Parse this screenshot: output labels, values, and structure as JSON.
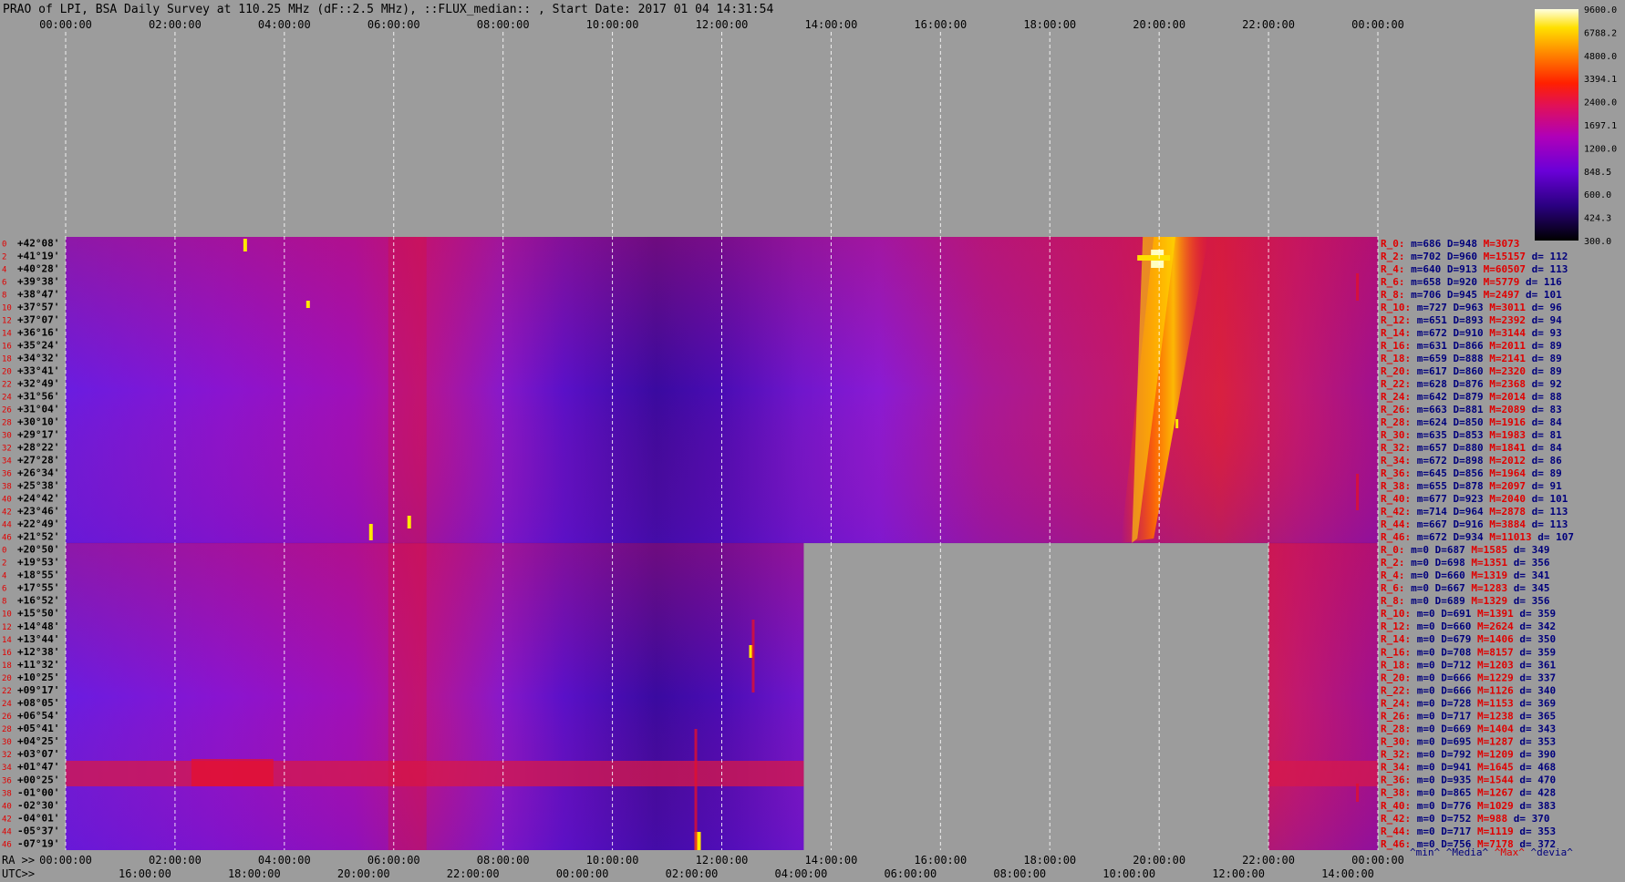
{
  "title": "PRAO of LPI, BSA Daily Survey at 110.25 MHz (dF::2.5 MHz), ::FLUX_median:: , Start Date: 2017 01 04 14:31:54",
  "colors": {
    "background": "#9c9c9c",
    "gap": "#9c9c9c",
    "axis_text": "#000000",
    "stats_label": "#e00000",
    "stats_blue": "#00007c",
    "stats_red": "#e00000",
    "grid": "#ffffff"
  },
  "chart_data": {
    "type": "heatmap",
    "title": "PRAO of LPI, BSA Daily Survey at 110.25 MHz (dF::2.5 MHz), ::FLUX_median:: , Start Date: 2017 01 04 14:31:54",
    "x_ra_ticks": [
      "00:00:00",
      "02:00:00",
      "04:00:00",
      "06:00:00",
      "08:00:00",
      "10:00:00",
      "12:00:00",
      "14:00:00",
      "16:00:00",
      "18:00:00",
      "20:00:00",
      "22:00:00",
      "00:00:00"
    ],
    "x_utc_ticks": [
      "16:00:00",
      "18:00:00",
      "20:00:00",
      "22:00:00",
      "00:00:00",
      "02:00:00",
      "04:00:00",
      "06:00:00",
      "08:00:00",
      "10:00:00",
      "12:00:00",
      "14:00:00"
    ],
    "ra_axis_label": "RA >>",
    "utc_axis_label": "UTC>>",
    "x_range_hours": [
      0,
      24
    ],
    "grid": true,
    "colorbar": {
      "ticks": [
        "9600.0",
        "6788.2",
        "4800.0",
        "3394.1",
        "2400.0",
        "1697.1",
        "1200.0",
        "848.5",
        "600.0",
        "424.3",
        "300.0"
      ],
      "range": [
        300,
        9600
      ],
      "scale": "log",
      "colormap": "gnuplot"
    },
    "block1": {
      "row_numbers": [
        "0",
        "2",
        "4",
        "6",
        "8",
        "10",
        "12",
        "14",
        "16",
        "18",
        "20",
        "22",
        "24",
        "26",
        "28",
        "30",
        "32",
        "34",
        "36",
        "38",
        "40",
        "42",
        "44",
        "46"
      ],
      "declinations": [
        "+42°08'",
        "+41°19'",
        "+40°28'",
        "+39°38'",
        "+38°47'",
        "+37°57'",
        "+37°07'",
        "+36°16'",
        "+35°24'",
        "+34°32'",
        "+33°41'",
        "+32°49'",
        "+31°56'",
        "+31°04'",
        "+30°10'",
        "+29°17'",
        "+28°22'",
        "+27°28'",
        "+26°34'",
        "+25°38'",
        "+24°42'",
        "+23°46'",
        "+22°49'",
        "+21°52'"
      ],
      "data_x_range_hours": [
        0,
        24
      ]
    },
    "block2": {
      "row_numbers": [
        "0",
        "2",
        "4",
        "6",
        "8",
        "10",
        "12",
        "14",
        "16",
        "18",
        "20",
        "22",
        "24",
        "26",
        "28",
        "30",
        "32",
        "34",
        "36",
        "38",
        "40",
        "42",
        "44",
        "46"
      ],
      "declinations": [
        "+20°50'",
        "+19°53'",
        "+18°55'",
        "+17°55'",
        "+16°52'",
        "+15°50'",
        "+14°48'",
        "+13°44'",
        "+12°38'",
        "+11°32'",
        "+10°25'",
        "+09°17'",
        "+08°05'",
        "+06°54'",
        "+05°41'",
        "+04°25'",
        "+03°07'",
        "+01°47'",
        "+00°25'",
        "-01°00'",
        "-02°30'",
        "-04°01'",
        "-05°37'",
        "-07°19'"
      ],
      "data_x_ranges_hours": [
        [
          0,
          13.5
        ],
        [
          22,
          24
        ]
      ],
      "gap_x_range_hours": [
        13.5,
        22
      ]
    },
    "stats_block1": [
      {
        "label": "R_0:",
        "m": "686",
        "D": "948",
        "M": "3073",
        "d": ""
      },
      {
        "label": "R_2:",
        "m": "702",
        "D": "960",
        "M": "15157",
        "d": "112"
      },
      {
        "label": "R_4:",
        "m": "640",
        "D": "913",
        "M": "60507",
        "d": "113"
      },
      {
        "label": "R_6:",
        "m": "658",
        "D": "920",
        "M": "5779",
        "d": "116"
      },
      {
        "label": "R_8:",
        "m": "706",
        "D": "945",
        "M": "2497",
        "d": "101"
      },
      {
        "label": "R_10:",
        "m": "727",
        "D": "963",
        "M": "3011",
        "d": "96"
      },
      {
        "label": "R_12:",
        "m": "651",
        "D": "893",
        "M": "2392",
        "d": "94"
      },
      {
        "label": "R_14:",
        "m": "672",
        "D": "910",
        "M": "3144",
        "d": "93"
      },
      {
        "label": "R_16:",
        "m": "631",
        "D": "866",
        "M": "2011",
        "d": "89"
      },
      {
        "label": "R_18:",
        "m": "659",
        "D": "888",
        "M": "2141",
        "d": "89"
      },
      {
        "label": "R_20:",
        "m": "617",
        "D": "860",
        "M": "2320",
        "d": "89"
      },
      {
        "label": "R_22:",
        "m": "628",
        "D": "876",
        "M": "2368",
        "d": "92"
      },
      {
        "label": "R_24:",
        "m": "642",
        "D": "879",
        "M": "2014",
        "d": "88"
      },
      {
        "label": "R_26:",
        "m": "663",
        "D": "881",
        "M": "2089",
        "d": "83"
      },
      {
        "label": "R_28:",
        "m": "624",
        "D": "850",
        "M": "1916",
        "d": "84"
      },
      {
        "label": "R_30:",
        "m": "635",
        "D": "853",
        "M": "1983",
        "d": "81"
      },
      {
        "label": "R_32:",
        "m": "657",
        "D": "880",
        "M": "1841",
        "d": "84"
      },
      {
        "label": "R_34:",
        "m": "672",
        "D": "898",
        "M": "2012",
        "d": "86"
      },
      {
        "label": "R_36:",
        "m": "645",
        "D": "856",
        "M": "1964",
        "d": "89"
      },
      {
        "label": "R_38:",
        "m": "655",
        "D": "878",
        "M": "2097",
        "d": "91"
      },
      {
        "label": "R_40:",
        "m": "677",
        "D": "923",
        "M": "2040",
        "d": "101"
      },
      {
        "label": "R_42:",
        "m": "714",
        "D": "964",
        "M": "2878",
        "d": "113"
      },
      {
        "label": "R_44:",
        "m": "667",
        "D": "916",
        "M": "3884",
        "d": "113"
      },
      {
        "label": "R_46:",
        "m": "672",
        "D": "934",
        "M": "11013",
        "d": "107"
      }
    ],
    "stats_block2": [
      {
        "label": "R_0:",
        "m": "0",
        "D": "687",
        "M": "1585",
        "d": "349"
      },
      {
        "label": "R_2:",
        "m": "0",
        "D": "698",
        "M": "1351",
        "d": "356"
      },
      {
        "label": "R_4:",
        "m": "0",
        "D": "660",
        "M": "1319",
        "d": "341"
      },
      {
        "label": "R_6:",
        "m": "0",
        "D": "667",
        "M": "1283",
        "d": "345"
      },
      {
        "label": "R_8:",
        "m": "0",
        "D": "689",
        "M": "1329",
        "d": "356"
      },
      {
        "label": "R_10:",
        "m": "0",
        "D": "691",
        "M": "1391",
        "d": "359"
      },
      {
        "label": "R_12:",
        "m": "0",
        "D": "660",
        "M": "2624",
        "d": "342"
      },
      {
        "label": "R_14:",
        "m": "0",
        "D": "679",
        "M": "1406",
        "d": "350"
      },
      {
        "label": "R_16:",
        "m": "0",
        "D": "708",
        "M": "8157",
        "d": "359"
      },
      {
        "label": "R_18:",
        "m": "0",
        "D": "712",
        "M": "1203",
        "d": "361"
      },
      {
        "label": "R_20:",
        "m": "0",
        "D": "666",
        "M": "1229",
        "d": "337"
      },
      {
        "label": "R_22:",
        "m": "0",
        "D": "666",
        "M": "1126",
        "d": "340"
      },
      {
        "label": "R_24:",
        "m": "0",
        "D": "728",
        "M": "1153",
        "d": "369"
      },
      {
        "label": "R_26:",
        "m": "0",
        "D": "717",
        "M": "1238",
        "d": "365"
      },
      {
        "label": "R_28:",
        "m": "0",
        "D": "669",
        "M": "1404",
        "d": "343"
      },
      {
        "label": "R_30:",
        "m": "0",
        "D": "695",
        "M": "1287",
        "d": "353"
      },
      {
        "label": "R_32:",
        "m": "0",
        "D": "792",
        "M": "1209",
        "d": "390"
      },
      {
        "label": "R_34:",
        "m": "0",
        "D": "941",
        "M": "1645",
        "d": "468"
      },
      {
        "label": "R_36:",
        "m": "0",
        "D": "935",
        "M": "1544",
        "d": "470"
      },
      {
        "label": "R_38:",
        "m": "0",
        "D": "865",
        "M": "1267",
        "d": "428"
      },
      {
        "label": "R_40:",
        "m": "0",
        "D": "776",
        "M": "1029",
        "d": "383"
      },
      {
        "label": "R_42:",
        "m": "0",
        "D": "752",
        "M": "988",
        "d": "370"
      },
      {
        "label": "R_44:",
        "m": "0",
        "D": "717",
        "M": "1119",
        "d": "353"
      },
      {
        "label": "R_46:",
        "m": "0",
        "D": "756",
        "M": "7178",
        "d": "372"
      }
    ],
    "stats_legend": [
      {
        "text": "^min^",
        "color": "#00007c"
      },
      {
        "text": "^Media^",
        "color": "#00007c"
      },
      {
        "text": "^Max^",
        "color": "#e00000"
      },
      {
        "text": "^devia^",
        "color": "#00007c"
      }
    ]
  }
}
